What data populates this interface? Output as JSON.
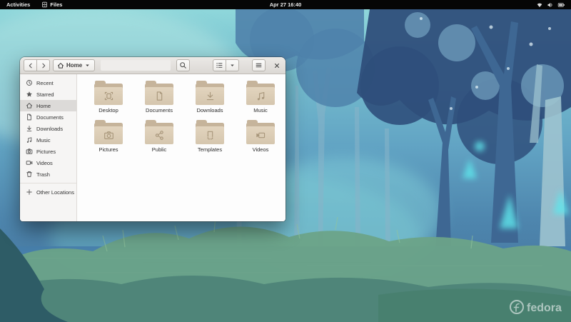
{
  "topbar": {
    "activities": "Activities",
    "app_name": "Files",
    "app_icon": "files-app-icon",
    "clock": "Apr 27 16:40",
    "status_icons": [
      "wifi-icon",
      "volume-icon",
      "battery-icon"
    ]
  },
  "window": {
    "headerbar": {
      "back_icon": "back-icon",
      "forward_icon": "forward-icon",
      "location": {
        "icon": "home-icon",
        "label": "Home",
        "caret_icon": "caret-down-icon"
      },
      "search_icon": "search-icon",
      "view_toggle": {
        "list_icon": "list-view-icon",
        "caret_icon": "caret-down-icon"
      },
      "menu_icon": "menu-icon",
      "close_icon": "close-icon"
    },
    "sidebar": {
      "items": [
        {
          "label": "Recent",
          "icon": "recent-icon",
          "selected": false
        },
        {
          "label": "Starred",
          "icon": "starred-icon",
          "selected": false
        },
        {
          "label": "Home",
          "icon": "home-icon",
          "selected": true
        },
        {
          "label": "Documents",
          "icon": "documents-icon",
          "selected": false
        },
        {
          "label": "Downloads",
          "icon": "downloads-icon",
          "selected": false
        },
        {
          "label": "Music",
          "icon": "music-icon",
          "selected": false
        },
        {
          "label": "Pictures",
          "icon": "pictures-icon",
          "selected": false
        },
        {
          "label": "Videos",
          "icon": "videos-icon",
          "selected": false
        },
        {
          "label": "Trash",
          "icon": "trash-icon",
          "selected": false
        }
      ],
      "other_locations": {
        "label": "Other Locations",
        "icon": "plus-icon"
      }
    },
    "folders": [
      {
        "name": "Desktop",
        "emblem": "emblem-desktop-icon"
      },
      {
        "name": "Documents",
        "emblem": "emblem-document-icon"
      },
      {
        "name": "Downloads",
        "emblem": "emblem-download-icon"
      },
      {
        "name": "Music",
        "emblem": "emblem-music-icon"
      },
      {
        "name": "Pictures",
        "emblem": "emblem-camera-icon"
      },
      {
        "name": "Public",
        "emblem": "emblem-share-icon"
      },
      {
        "name": "Templates",
        "emblem": "emblem-template-icon"
      },
      {
        "name": "Videos",
        "emblem": "emblem-video-icon"
      }
    ]
  },
  "wallpaper": {
    "watermark": "fedora"
  },
  "colors": {
    "topbar_bg": "#060606",
    "headerbar_bg": "#e5e3e0",
    "sidebar_selected": "#dcdad8",
    "folder_back": "#c6b49b",
    "folder_front": "#dbccb5",
    "folder_emblem": "#a8967a",
    "wallpaper_dark_tree": "#2f4f7b",
    "wallpaper_light_cyan": "#8fe2e4",
    "grass_green": "#6ba388"
  }
}
